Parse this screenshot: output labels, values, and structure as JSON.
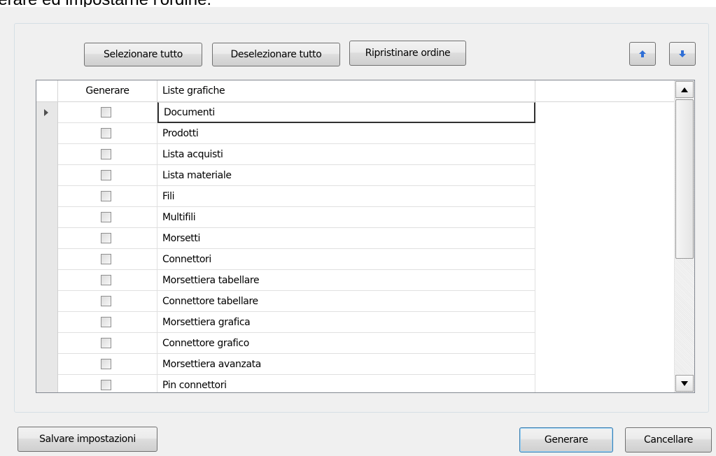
{
  "heading": {
    "text": "lerare ed impostarne l'ordine."
  },
  "toolbar": {
    "select_all_label": "Selezionare tutto",
    "deselect_all_label": "Deselezionare tutto",
    "restore_order_label": "Ripristinare ordine",
    "move_up_icon": "arrow-up-icon",
    "move_down_icon": "arrow-down-icon"
  },
  "grid": {
    "columns": [
      "Generare",
      "Liste grafiche"
    ],
    "rows": [
      {
        "label": "Documenti",
        "checked": false
      },
      {
        "label": "Prodotti",
        "checked": false
      },
      {
        "label": "Lista acquisti",
        "checked": false
      },
      {
        "label": "Lista materiale",
        "checked": false
      },
      {
        "label": "Fili",
        "checked": false
      },
      {
        "label": "Multifili",
        "checked": false
      },
      {
        "label": "Morsetti",
        "checked": false
      },
      {
        "label": "Connettori",
        "checked": false
      },
      {
        "label": "Morsettiera tabellare",
        "checked": false
      },
      {
        "label": "Connettore tabellare",
        "checked": false
      },
      {
        "label": "Morsettiera grafica",
        "checked": false
      },
      {
        "label": "Connettore grafico",
        "checked": false
      },
      {
        "label": "Morsettiera avanzata",
        "checked": false
      },
      {
        "label": "Pin connettori",
        "checked": false
      }
    ]
  },
  "footer": {
    "save_settings_label": "Salvare impostazioni",
    "generate_label": "Generare",
    "cancel_label": "Cancellare"
  },
  "colors": {
    "dialog_bg": "#f0f0f0",
    "focus_border": "#3c7fb1",
    "arrow_blue": "#2f6fd6"
  }
}
